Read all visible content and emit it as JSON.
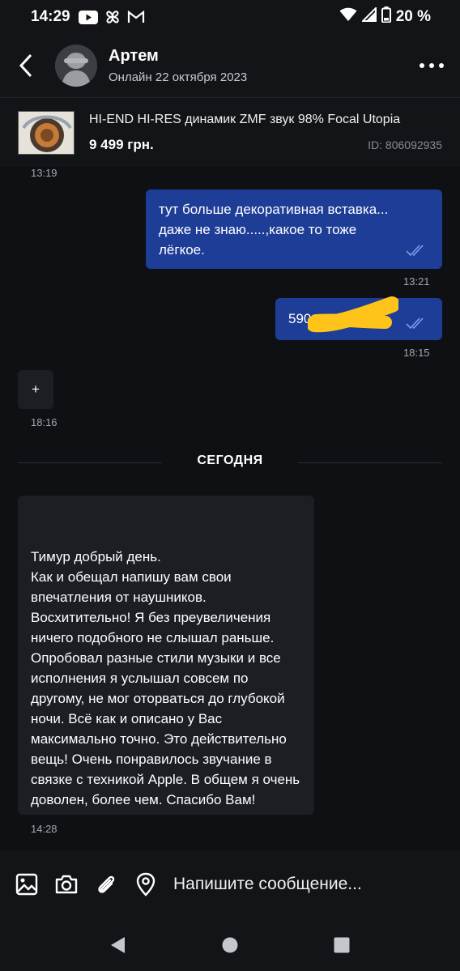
{
  "status_bar": {
    "time": "14:29",
    "battery": "20 %"
  },
  "header": {
    "name": "Артем",
    "status": "Онлайн 22 октября 2023"
  },
  "product": {
    "title": "HI-END HI-RES динамик ZMF звук 98% Focal Utopia",
    "price": "9 499 грн.",
    "id": "ID: 806092935"
  },
  "messages": [
    {
      "time": "13:19"
    },
    {
      "direction": "out",
      "text": "тут больше декоративная вставка... даже не знаю.....,какое то тоже лёгкое.",
      "time": "13:21"
    },
    {
      "direction": "out",
      "text": "590",
      "time": "18:15"
    },
    {
      "direction": "in",
      "text": "+",
      "time": "18:16"
    },
    {
      "direction": "in",
      "text": "Тимур добрый день.\nКак и обещал напишу вам свои впечатления от наушников. Восхитительно! Я без преувеличения ничего подобного не слышал раньше. Опробовал разные стили музыки и все исполнения я услышал совсем по другому, не мог оторваться до глубокой ночи. Всё как и описано у Вас максимально точно. Это действительно вещь! Очень понравилось звучание в связке с техникой Apple. В общем я очень доволен, более чем. Спасибо Вам!",
      "time": "14:28"
    }
  ],
  "date_divider": "СЕГОДНЯ",
  "composer": {
    "placeholder": "Напишите сообщение..."
  },
  "colors": {
    "outgoing_bubble": "#1e3d97",
    "incoming_bubble": "#1c1e23",
    "background": "#0f1013",
    "bars": "#131418"
  }
}
